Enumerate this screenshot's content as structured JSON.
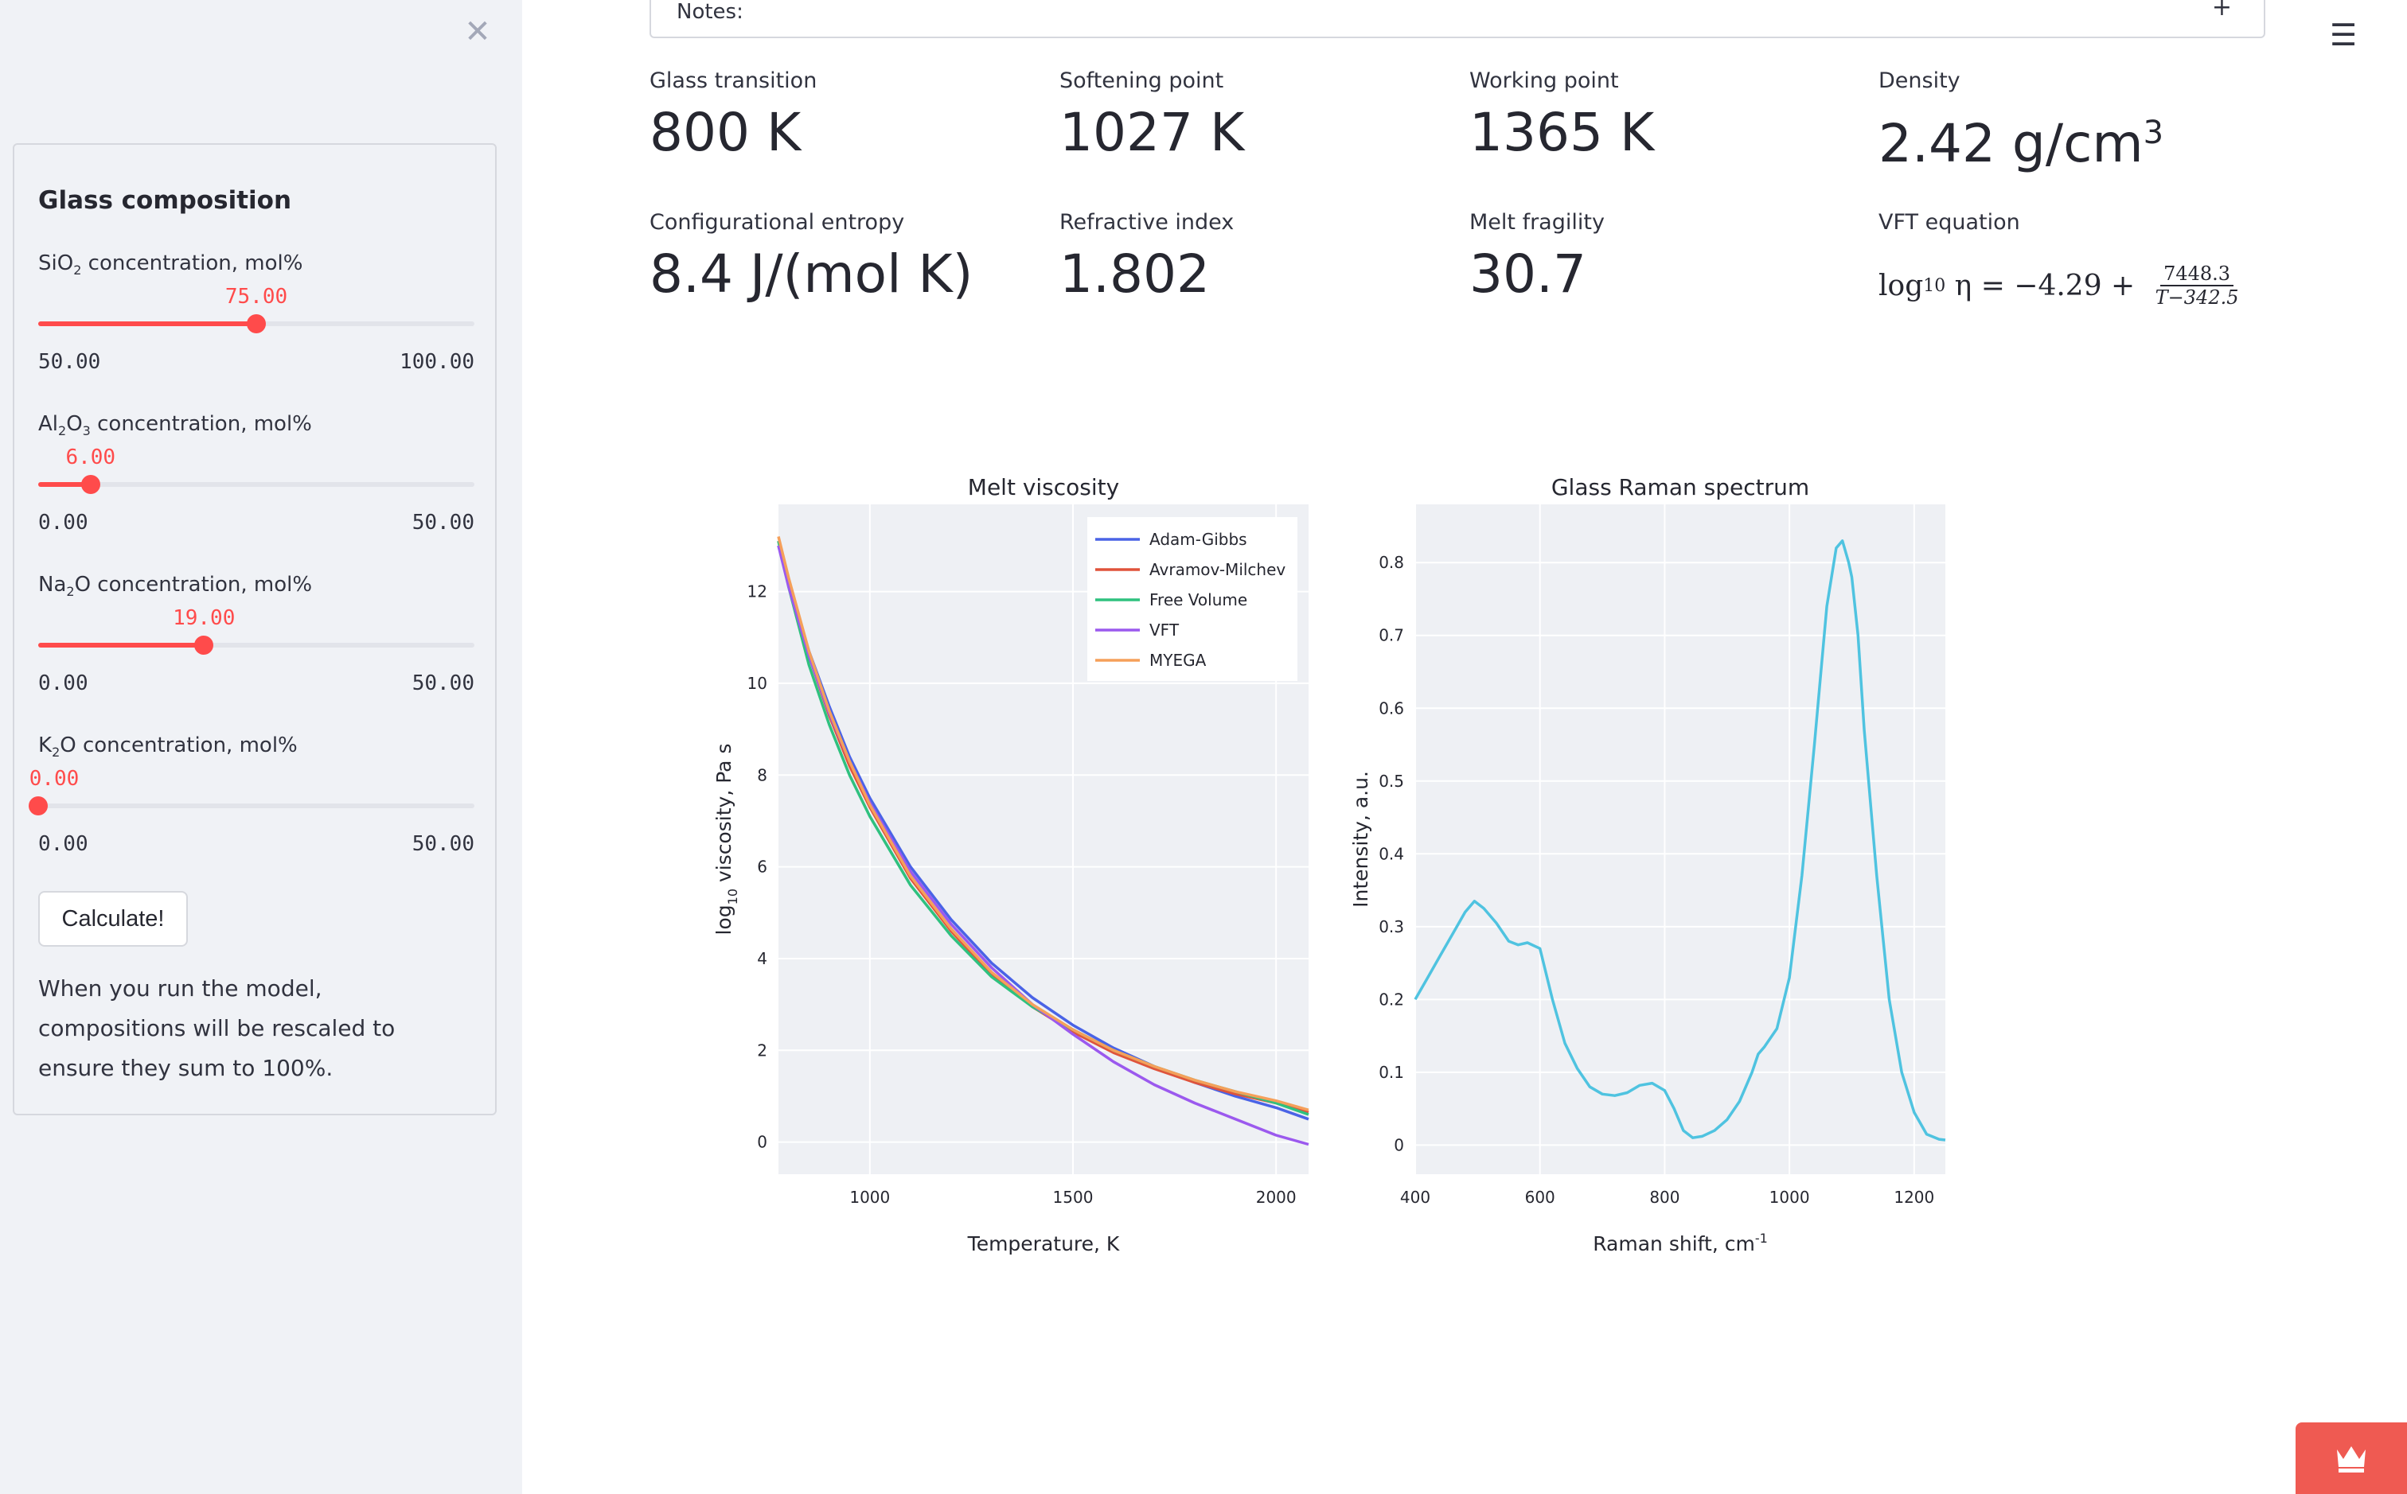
{
  "sidebar": {
    "close_icon": "close-icon",
    "panel_title": "Glass composition",
    "sliders": [
      {
        "label_pre": "SiO",
        "label_sub": "2",
        "label_mid": "",
        "label_sub2": "",
        "label_post": " concentration, mol%",
        "value": "75.00",
        "value_num": 75,
        "min": "50.00",
        "min_num": 50,
        "max": "100.00",
        "max_num": 100
      },
      {
        "label_pre": "Al",
        "label_sub": "2",
        "label_mid": "O",
        "label_sub2": "3",
        "label_post": " concentration, mol%",
        "value": "6.00",
        "value_num": 6,
        "min": "0.00",
        "min_num": 0,
        "max": "50.00",
        "max_num": 50
      },
      {
        "label_pre": "Na",
        "label_sub": "2",
        "label_mid": "O",
        "label_sub2": "",
        "label_post": " concentration, mol%",
        "value": "19.00",
        "value_num": 19,
        "min": "0.00",
        "min_num": 0,
        "max": "50.00",
        "max_num": 50
      },
      {
        "label_pre": "K",
        "label_sub": "2",
        "label_mid": "O",
        "label_sub2": "",
        "label_post": " concentration, mol%",
        "value": "0.00",
        "value_num": 0,
        "min": "0.00",
        "min_num": 0,
        "max": "50.00",
        "max_num": 50
      }
    ],
    "calculate_label": "Calculate!",
    "note": "When you run the model, compositions will be rescaled to ensure they sum to 100%.",
    "accent_color": "#ff4b4b"
  },
  "main": {
    "notes_label": "Notes:",
    "notes_plus": "+",
    "menu_icon": "hamburger-menu-icon",
    "metrics": [
      {
        "label": "Glass transition",
        "value": "800 K"
      },
      {
        "label": "Softening point",
        "value": "1027 K"
      },
      {
        "label": "Working point",
        "value": "1365 K"
      },
      {
        "label": "Density",
        "value": "2.42 g/cm",
        "value_sup": "3"
      },
      {
        "label": "Configurational entropy",
        "value": "8.4 J/(mol K)"
      },
      {
        "label": "Refractive index",
        "value": "1.802"
      },
      {
        "label": "Melt fragility",
        "value": "30.7"
      },
      {
        "label": "VFT equation",
        "value": ""
      }
    ],
    "vft": {
      "prefix": "log",
      "sub": "10",
      "rest": " η = −4.29 + ",
      "numerator": "7448.3",
      "denominator": "T−342.5"
    }
  },
  "chart_data": [
    {
      "type": "line",
      "title": "Melt viscosity",
      "xlabel": "Temperature, K",
      "ylabel_pre": "log",
      "ylabel_sub": "10",
      "ylabel_post": " viscosity, Pa s",
      "xlim": [
        775,
        2080
      ],
      "ylim": [
        -0.7,
        13.9
      ],
      "xticks": [
        1000,
        1500,
        2000
      ],
      "yticks": [
        0,
        2,
        4,
        6,
        8,
        10,
        12
      ],
      "grid": true,
      "legend_position": "top-right",
      "series": [
        {
          "name": "Adam-Gibbs",
          "color": "#4a63e6",
          "x": [
            775,
            800,
            850,
            900,
            950,
            1000,
            1100,
            1200,
            1300,
            1400,
            1500,
            1600,
            1700,
            1800,
            1900,
            2000,
            2080
          ],
          "y": [
            13.0,
            12.2,
            10.7,
            9.5,
            8.4,
            7.5,
            6.0,
            4.85,
            3.9,
            3.15,
            2.55,
            2.05,
            1.65,
            1.3,
            1.0,
            0.75,
            0.5
          ]
        },
        {
          "name": "Avramov-Milchev",
          "color": "#e0533b",
          "x": [
            775,
            800,
            850,
            900,
            950,
            1000,
            1100,
            1200,
            1300,
            1400,
            1500,
            1600,
            1700,
            1800,
            1900,
            2000,
            2080
          ],
          "y": [
            13.1,
            12.2,
            10.6,
            9.3,
            8.2,
            7.3,
            5.75,
            4.6,
            3.65,
            2.95,
            2.4,
            1.95,
            1.6,
            1.3,
            1.05,
            0.85,
            0.65
          ]
        },
        {
          "name": "Free Volume",
          "color": "#2fc17f",
          "x": [
            775,
            800,
            850,
            900,
            950,
            1000,
            1100,
            1200,
            1300,
            1400,
            1500,
            1600,
            1700,
            1800,
            1900,
            2000,
            2080
          ],
          "y": [
            13.1,
            12.1,
            10.4,
            9.1,
            8.0,
            7.1,
            5.6,
            4.5,
            3.6,
            2.95,
            2.45,
            2.0,
            1.65,
            1.35,
            1.1,
            0.85,
            0.6
          ]
        },
        {
          "name": "VFT",
          "color": "#9b59ee",
          "x": [
            775,
            800,
            850,
            900,
            950,
            1000,
            1100,
            1200,
            1300,
            1400,
            1500,
            1600,
            1700,
            1800,
            1900,
            2000,
            2080
          ],
          "y": [
            13.0,
            12.1,
            10.6,
            9.35,
            8.3,
            7.4,
            5.9,
            4.75,
            3.8,
            3.0,
            2.35,
            1.75,
            1.25,
            0.85,
            0.5,
            0.15,
            -0.05
          ]
        },
        {
          "name": "MYEGA",
          "color": "#f5a05a",
          "x": [
            775,
            800,
            850,
            900,
            950,
            1000,
            1100,
            1200,
            1300,
            1400,
            1500,
            1600,
            1700,
            1800,
            1900,
            2000,
            2080
          ],
          "y": [
            13.2,
            12.3,
            10.7,
            9.4,
            8.3,
            7.35,
            5.8,
            4.65,
            3.7,
            3.0,
            2.45,
            2.0,
            1.65,
            1.35,
            1.1,
            0.9,
            0.7
          ]
        }
      ]
    },
    {
      "type": "line",
      "title": "Glass Raman spectrum",
      "xlabel_pre": "Raman shift, cm",
      "xlabel_sup": "-1",
      "ylabel": "Intensity, a.u.",
      "xlim": [
        400,
        1250
      ],
      "ylim": [
        -0.04,
        0.88
      ],
      "xticks": [
        400,
        600,
        800,
        1000,
        1200
      ],
      "yticks": [
        0,
        0.1,
        0.2,
        0.3,
        0.4,
        0.5,
        0.6,
        0.7,
        0.8
      ],
      "grid": true,
      "series": [
        {
          "color": "#4fc3e0",
          "x": [
            400,
            420,
            440,
            460,
            480,
            495,
            510,
            530,
            550,
            565,
            580,
            600,
            620,
            640,
            660,
            680,
            700,
            720,
            740,
            760,
            780,
            800,
            815,
            830,
            845,
            860,
            880,
            900,
            920,
            940,
            950,
            960,
            980,
            1000,
            1020,
            1040,
            1060,
            1075,
            1085,
            1095,
            1100,
            1110,
            1120,
            1140,
            1160,
            1180,
            1200,
            1220,
            1240,
            1250
          ],
          "y": [
            0.2,
            0.23,
            0.26,
            0.29,
            0.32,
            0.335,
            0.325,
            0.305,
            0.28,
            0.275,
            0.278,
            0.27,
            0.2,
            0.14,
            0.105,
            0.08,
            0.07,
            0.068,
            0.072,
            0.082,
            0.085,
            0.075,
            0.05,
            0.02,
            0.01,
            0.012,
            0.02,
            0.035,
            0.06,
            0.1,
            0.125,
            0.135,
            0.16,
            0.23,
            0.37,
            0.55,
            0.74,
            0.82,
            0.83,
            0.8,
            0.78,
            0.7,
            0.57,
            0.37,
            0.2,
            0.1,
            0.045,
            0.015,
            0.008,
            0.007
          ]
        }
      ]
    }
  ]
}
